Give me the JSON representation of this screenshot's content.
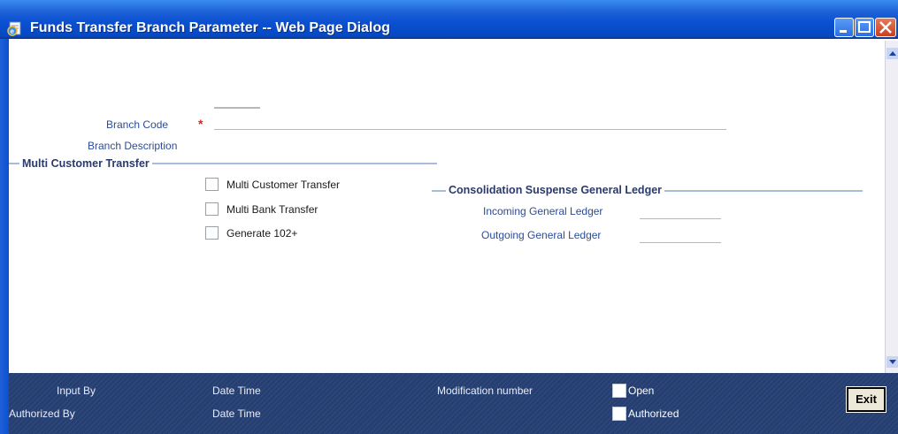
{
  "window": {
    "title": "Funds Transfer Branch Parameter -- Web Page Dialog"
  },
  "form": {
    "branch_code_label": "Branch Code",
    "required_marker": "*",
    "branch_code_value": "",
    "branch_description_label": "Branch Description",
    "branch_description_value": ""
  },
  "multi_customer_transfer": {
    "title": "Multi Customer Transfer",
    "options": [
      {
        "label": "Multi Customer Transfer",
        "checked": false
      },
      {
        "label": "Multi Bank Transfer",
        "checked": false
      },
      {
        "label": "Generate 102+",
        "checked": false
      }
    ]
  },
  "consolidation": {
    "title": "Consolidation Suspense General Ledger",
    "incoming_label": "Incoming General Ledger",
    "incoming_value": "",
    "outgoing_label": "Outgoing General Ledger",
    "outgoing_value": ""
  },
  "footer": {
    "input_by_label": "Input By",
    "authorized_by_label": "Authorized By",
    "date_time_label_1": "Date Time",
    "date_time_label_2": "Date Time",
    "modification_number_label": "Modification number",
    "open_label": "Open",
    "open_checked": false,
    "authorized_label": "Authorized",
    "authorized_checked": false,
    "exit_label": "Exit"
  },
  "colors": {
    "titlebar": "#0a50d0",
    "label_text": "#2b4c9a",
    "required": "#e02020",
    "footer_bg": "#263f72"
  }
}
